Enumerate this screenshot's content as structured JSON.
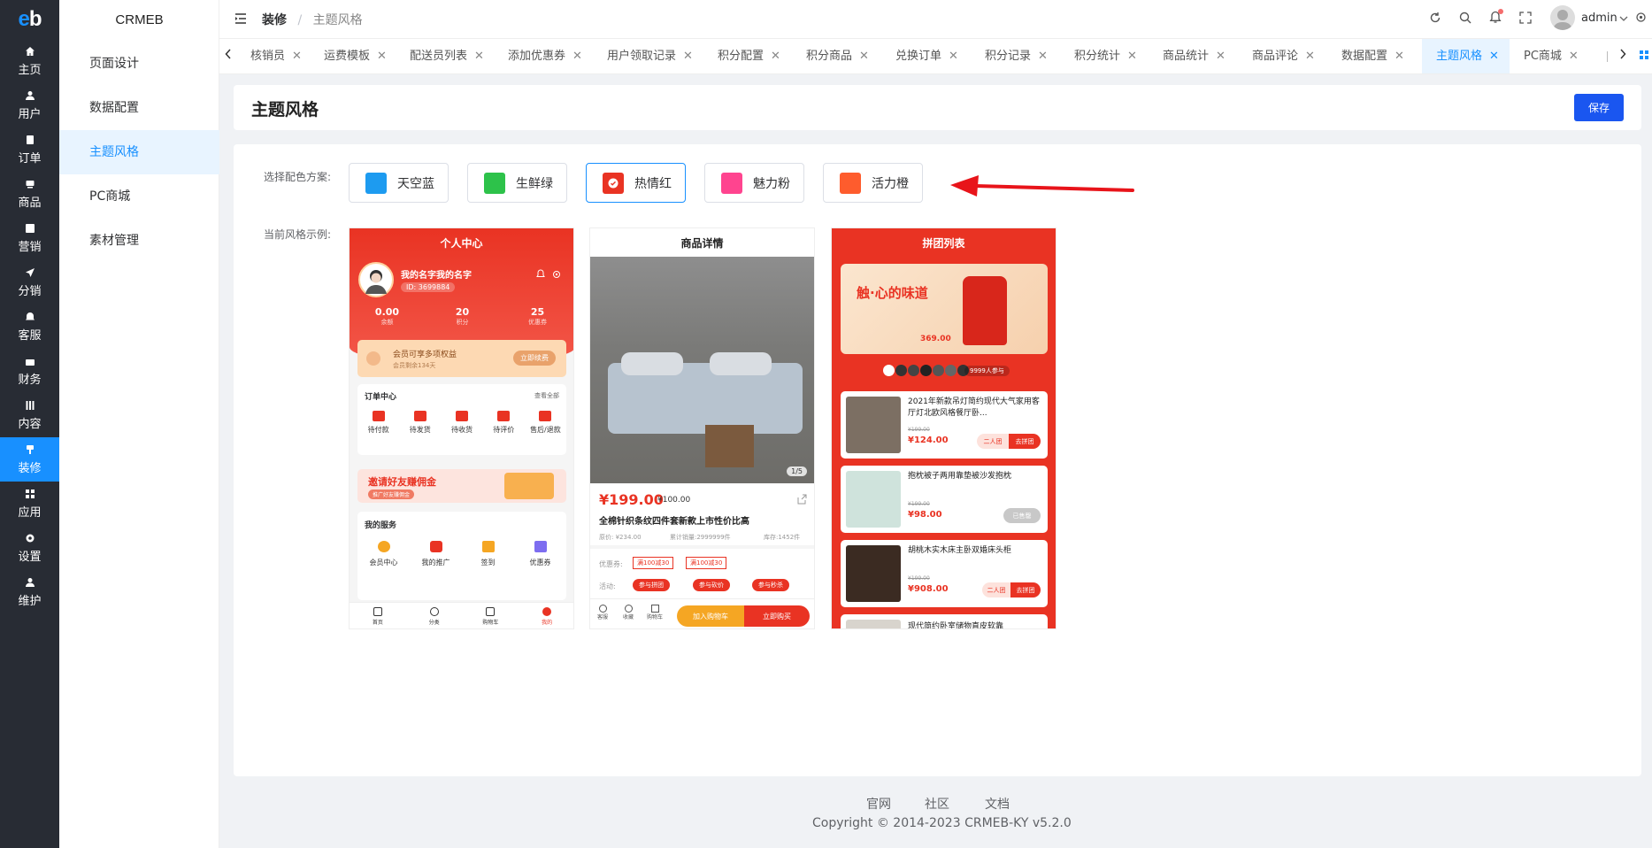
{
  "rail": {
    "logo": "eb",
    "items": [
      {
        "label": "主页",
        "icon": "home-icon"
      },
      {
        "label": "用户",
        "icon": "user-icon"
      },
      {
        "label": "订单",
        "icon": "order-icon"
      },
      {
        "label": "商品",
        "icon": "goods-icon"
      },
      {
        "label": "营销",
        "icon": "marketing-icon"
      },
      {
        "label": "分销",
        "icon": "distribution-icon"
      },
      {
        "label": "客服",
        "icon": "service-icon"
      },
      {
        "label": "财务",
        "icon": "finance-icon"
      },
      {
        "label": "内容",
        "icon": "content-icon"
      },
      {
        "label": "装修",
        "icon": "decor-icon"
      },
      {
        "label": "应用",
        "icon": "apps-icon"
      },
      {
        "label": "设置",
        "icon": "settings-icon"
      },
      {
        "label": "维护",
        "icon": "maintenance-icon"
      }
    ]
  },
  "sidebar": {
    "brand": "CRMEB",
    "items": [
      "页面设计",
      "数据配置",
      "主题风格",
      "PC商城",
      "素材管理"
    ]
  },
  "header": {
    "crumb_root": "装修",
    "crumb_sep": "/",
    "crumb_current": "主题风格",
    "user": "admin"
  },
  "tabs": [
    "核销员",
    "运费模板",
    "配送员列表",
    "添加优惠券",
    "用户领取记录",
    "积分配置",
    "积分商品",
    "兑换订单",
    "积分记录",
    "积分统计",
    "商品统计",
    "商品评论",
    "数据配置",
    "主题风格",
    "PC商城"
  ],
  "page": {
    "title": "主题风格",
    "save": "保存",
    "scheme_label": "选择配色方案:",
    "example_label": "当前风格示例:",
    "schemes": [
      {
        "name": "天空蓝",
        "color": "#1d9bf0"
      },
      {
        "name": "生鲜绿",
        "color": "#2dc24a"
      },
      {
        "name": "热情红",
        "color": "#e93323"
      },
      {
        "name": "魅力粉",
        "color": "#ff448f"
      },
      {
        "name": "活力橙",
        "color": "#fe5c2d"
      }
    ]
  },
  "personal": {
    "title": "个人中心",
    "name": "我的名字我的名字",
    "id": "ID: 3699884",
    "stats": [
      {
        "v": "0.00",
        "l": "余额"
      },
      {
        "v": "20",
        "l": "积分"
      },
      {
        "v": "25",
        "l": "优惠券"
      }
    ],
    "vip_title": "会员可享多项权益",
    "vip_sub": "会员剩余134天",
    "vip_btn": "立即续费",
    "orders_title": "订单中心",
    "orders_all": "查看全部",
    "orders": [
      "待付款",
      "待发货",
      "待收货",
      "待评价",
      "售后/退款"
    ],
    "invite": "邀请好友赚佣金",
    "invite_sub": "推广好友赚佣金",
    "service_title": "我的服务",
    "services": [
      "会员中心",
      "我的推广",
      "签到",
      "优惠券"
    ],
    "nav": [
      "首页",
      "分类",
      "购物车",
      "我的"
    ]
  },
  "detail": {
    "title": "商品详情",
    "counter": "1/5",
    "price": "¥199.00",
    "old_price": "¥100.00",
    "name": "全棉针织条纹四件套新款上市性价比高",
    "meta1": "原价: ¥234.00",
    "meta2": "累计销量:2999999件",
    "meta3": "库存:1452件",
    "coupon_label": "优惠券:",
    "coupons": [
      "满100减30",
      "满100减30"
    ],
    "activity_label": "活动:",
    "activities": [
      "参与拼团",
      "参与砍价",
      "参与秒杀"
    ],
    "bar_icons": [
      "客服",
      "收藏",
      "购物车"
    ],
    "cart_btn": "加入购物车",
    "buy_btn": "立即购买"
  },
  "group": {
    "title": "拼团列表",
    "banner_text": "触·心的味道",
    "banner_price": "369.00",
    "joined": "9999人参与",
    "items": [
      {
        "name": "2021年新款吊灯简约现代大气家用客厅灯北欧风格餐厅卧...",
        "old": "¥199.00",
        "price": "¥124.00",
        "tag": "二人团",
        "btn": "去拼团"
      },
      {
        "name": "抱枕被子两用靠垫被沙发抱枕",
        "old": "¥199.00",
        "price": "¥98.00",
        "tag": "",
        "btn": "已售罄"
      },
      {
        "name": "胡桃木实木床主卧双婚床头柜",
        "old": "¥199.00",
        "price": "¥908.00",
        "tag": "二人团",
        "btn": "去拼团"
      },
      {
        "name": "现代简约卧室储物直皮软靠",
        "old": "",
        "price": "",
        "tag": "",
        "btn": ""
      }
    ]
  },
  "footer": {
    "links": [
      "官网",
      "社区",
      "文档"
    ],
    "copyright": "Copyright © 2014-2023 CRMEB-KY v5.2.0"
  }
}
